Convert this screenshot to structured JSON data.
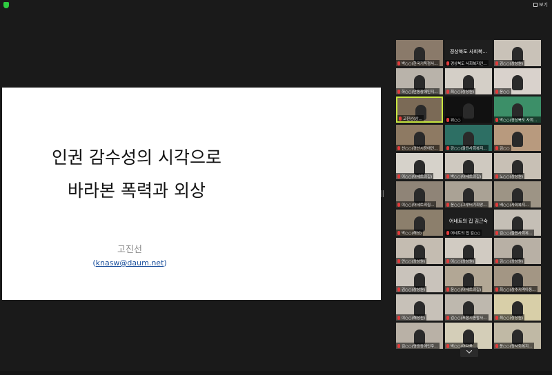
{
  "topbar": {
    "view_label": "보기"
  },
  "slide": {
    "title_line1": "인권 감수성의 시각으로",
    "title_line2": "바라본 폭력과 외상",
    "author": "고진선",
    "email": "knasw@daum.net"
  },
  "gallery": {
    "tiles": [
      {
        "name": "박○○(한국기독정사…",
        "bg": "#8a7a6a"
      },
      {
        "name": "경상북도 사회복지인…",
        "label": "경상북도 사회복…",
        "bg": "#1e1e1e"
      },
      {
        "name": "김○○(상상원)",
        "bg": "#c9c2b8"
      },
      {
        "name": "하○○(안동장애인지…",
        "bg": "#b9b3aa"
      },
      {
        "name": "최○○(상상원)",
        "bg": "#d4cfc7"
      },
      {
        "name": "윤○○",
        "bg": "#d9d2cc"
      },
      {
        "name": "고진선(상…",
        "bg": "#7b6a56",
        "active": true
      },
      {
        "name": "위○○",
        "bg": "#111111"
      },
      {
        "name": "박○○(경상북도 사회복…",
        "bg": "#3c8f68"
      },
      {
        "name": "신○○(경산시장애인…",
        "bg": "#8e7a63"
      },
      {
        "name": "강○○(울진사회복지…",
        "bg": "#2d6f64"
      },
      {
        "name": "김○○",
        "bg": "#b89a7e"
      },
      {
        "name": "이○○(어네트의집)",
        "bg": "#d6d2ca"
      },
      {
        "name": "박○○(어네트의집)",
        "bg": "#cfc9c0"
      },
      {
        "name": "노○○(상상원)",
        "bg": "#c8c0b5"
      },
      {
        "name": "이○○(어네트의집…",
        "bg": "#8f8477"
      },
      {
        "name": "윤○○(그루터기희망…",
        "bg": "#aaa295"
      },
      {
        "name": "배○○(사회복지…",
        "bg": "#9d9485"
      },
      {
        "name": "박○○(해성)",
        "bg": "#8c7f6c"
      },
      {
        "name": "어네트의 집 김○○",
        "label": "어네트의 집 김근숙",
        "bg": "#1e1e1e"
      },
      {
        "name": "김○○(울진사회복…",
        "bg": "#c5bfb6"
      },
      {
        "name": "안○○(상상원)",
        "bg": "#c4bcb1"
      },
      {
        "name": "이○○(상상원)",
        "bg": "#d1cbc2"
      },
      {
        "name": "김○○(상상원)",
        "bg": "#b8b0a5"
      },
      {
        "name": "김○○(상상원)",
        "bg": "#c9c3bb"
      },
      {
        "name": "윤○○(어네트의집)",
        "bg": "#b2a795"
      },
      {
        "name": "최○○(상주지역아동…",
        "bg": "#a39684"
      },
      {
        "name": "이○○(해성진)",
        "bg": "#c7c1b8"
      },
      {
        "name": "김○○(포항시종합사…",
        "bg": "#beb8ae"
      },
      {
        "name": "최○○(상상원)",
        "bg": "#d8cfa8"
      },
      {
        "name": "김○○(영광장애인주…",
        "bg": "#b9b1a6"
      },
      {
        "name": "박○○(어다움…",
        "bg": "#d4ceb8"
      },
      {
        "name": "윤○○(정사회복지…",
        "bg": "#c0b9a5"
      }
    ]
  }
}
